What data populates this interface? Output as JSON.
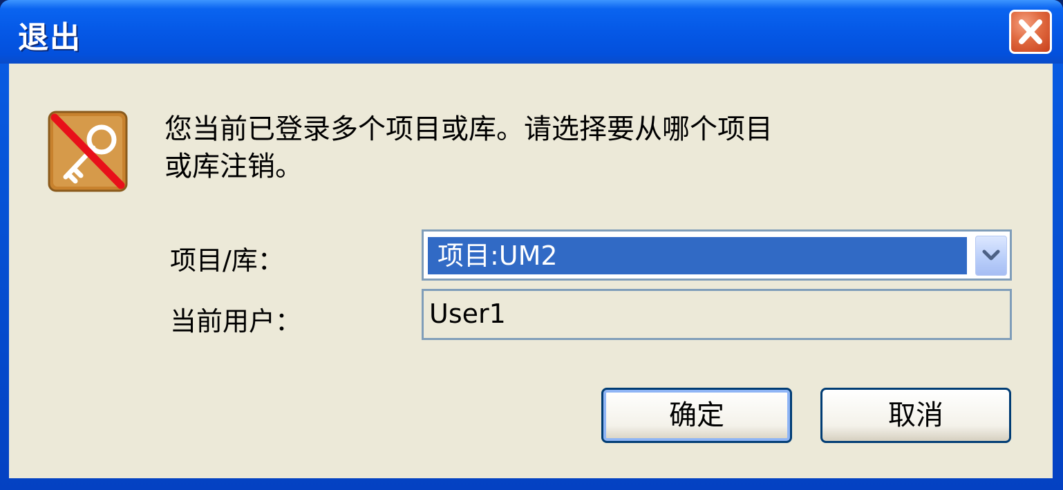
{
  "window": {
    "title": "退出"
  },
  "dialog": {
    "message_line1": "您当前已登录多个项目或库。请选择要从哪个项目",
    "message_line2": "或库注销。",
    "project_label": "项目/库：",
    "project_value": "项目:UM2",
    "user_label": "当前用户：",
    "user_value": "User1"
  },
  "buttons": {
    "ok_label": "确定",
    "cancel_label": "取消"
  },
  "icons": {
    "close": "close-icon",
    "logout": "logout-key-icon",
    "dropdown": "chevron-down-icon"
  },
  "colors": {
    "titlebar": "#0558e6",
    "client": "#ece9d8",
    "selection": "#316ac5",
    "close": "#e06a40",
    "border": "#7f9db9"
  }
}
